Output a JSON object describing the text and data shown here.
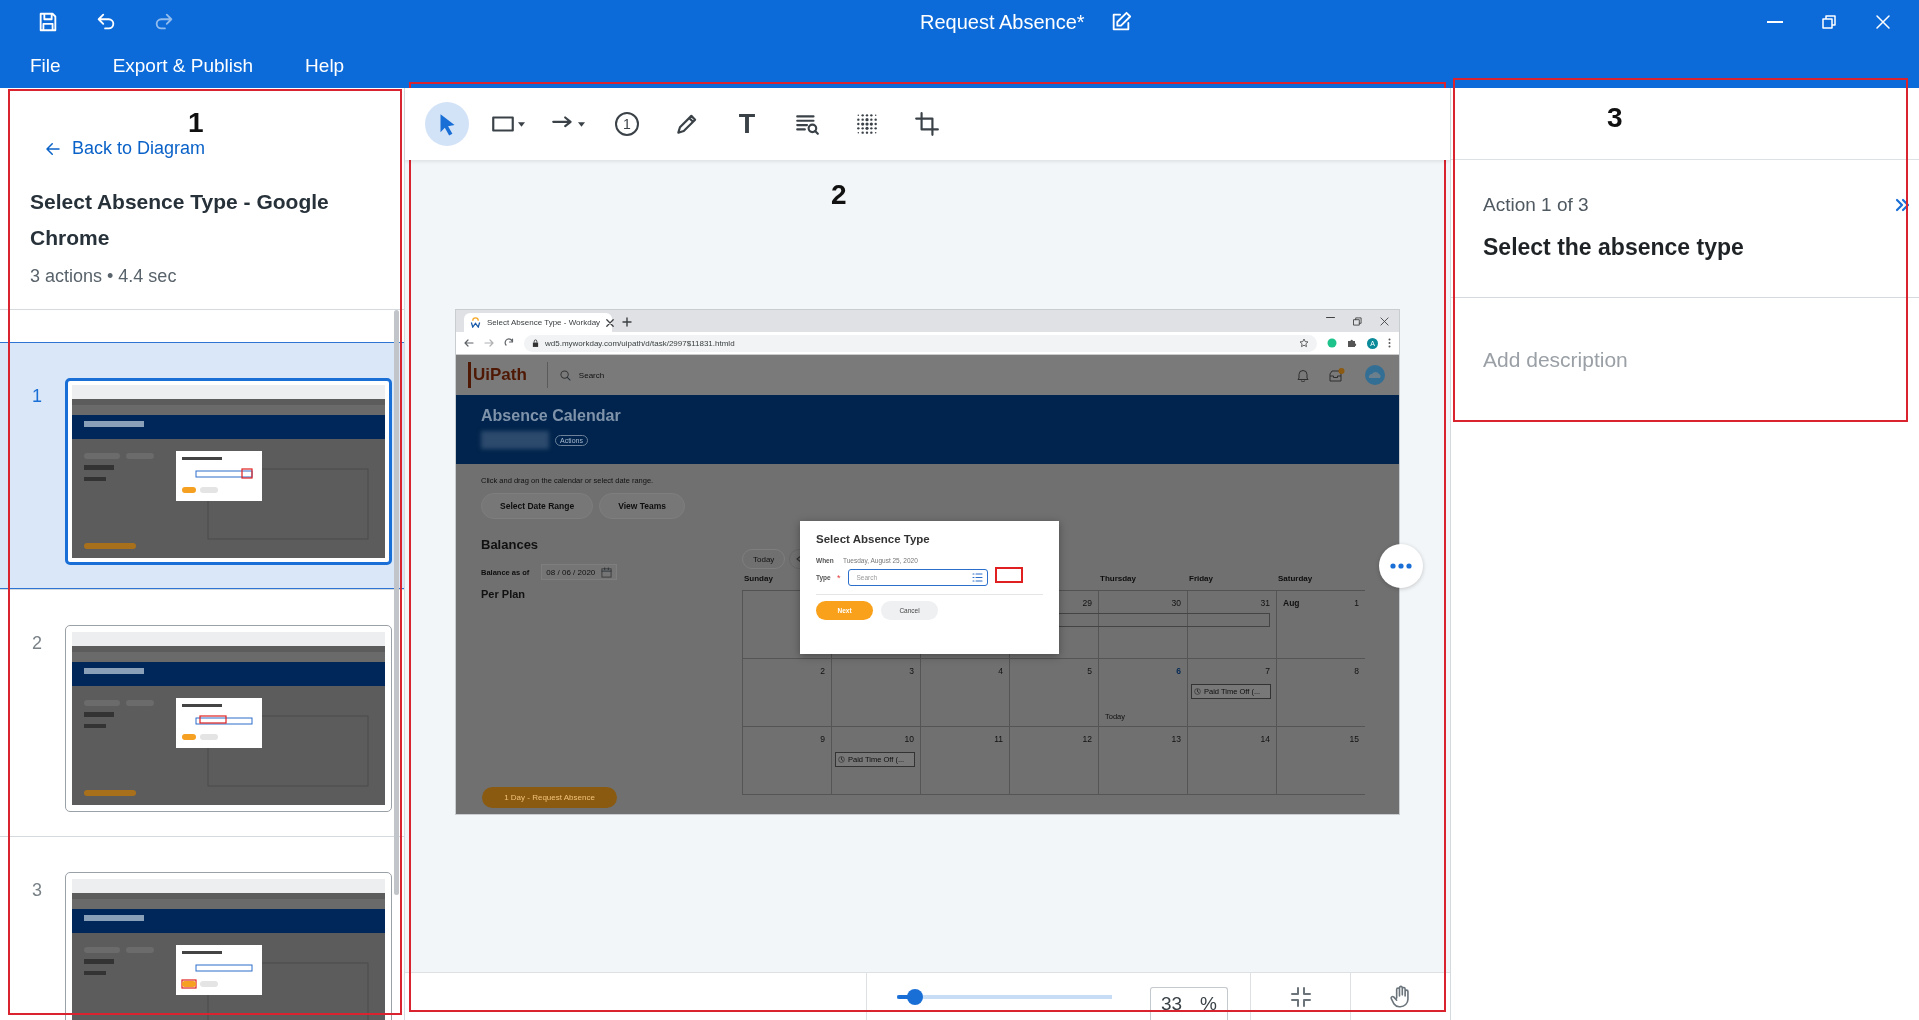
{
  "title_bar": {
    "title": "Request Absence*",
    "history": [
      {
        "kind": "undo",
        "disabled": false
      },
      {
        "kind": "redo",
        "disabled": true
      }
    ]
  },
  "menu": [
    {
      "label": "File"
    },
    {
      "label": "Export & Publish"
    },
    {
      "label": "Help"
    }
  ],
  "left_panel": {
    "back_link": "Back to Diagram",
    "recording_title": "Select Absence Type - Google Chrome",
    "summary": "3 actions • 4.4 sec",
    "steps": [
      {
        "number": "1",
        "selected": true
      },
      {
        "number": "2",
        "selected": false
      },
      {
        "number": "3",
        "selected": false
      }
    ]
  },
  "toolbar": {
    "tools": [
      {
        "kind": "select",
        "selected": true
      },
      {
        "kind": "rectangle",
        "selected": false,
        "has_menu": true
      },
      {
        "kind": "arrow",
        "selected": false,
        "has_menu": true
      },
      {
        "kind": "step",
        "label": "1",
        "selected": false
      },
      {
        "kind": "pen",
        "selected": false
      },
      {
        "kind": "text",
        "label": "T",
        "selected": false
      },
      {
        "kind": "ocr",
        "selected": false
      },
      {
        "kind": "blur",
        "selected": false
      },
      {
        "kind": "crop",
        "selected": false
      }
    ]
  },
  "canvas": {
    "screenshot": {
      "browser": {
        "tab_title": "Select Absence Type - Workday",
        "url": "wd5.myworkday.com/uipath/d/task/2997$11831.htmld",
        "profile_initial": "A"
      },
      "app": {
        "logo": "UiPath",
        "search_placeholder": "Search",
        "page_title": "Absence Calendar",
        "actions_label": "Actions",
        "hint": "Click and drag on the calendar or select date range.",
        "buttons": [
          "Select Date Range",
          "View Teams"
        ],
        "balances_title": "Balances",
        "balance_label": "Balance as of",
        "balance_date": "08 / 06 / 2020",
        "plan_title": "Per Plan",
        "request_button": "1 Day - Request Absence"
      },
      "calendar": {
        "today_button": "Today",
        "weekdays": {
          "first": "Sunday",
          "last_three": [
            "Thursday",
            "Friday",
            "Saturday"
          ]
        },
        "weeks": [
          {
            "bar": true,
            "cells": [
              {},
              {},
              {},
              {
                "day": "29"
              },
              {
                "day": "30"
              },
              {
                "day": "31"
              },
              {
                "month": "Aug",
                "day": "1"
              }
            ]
          },
          {
            "cells": [
              {
                "day": "2"
              },
              {
                "day": "3"
              },
              {
                "day": "4"
              },
              {
                "day": "5"
              },
              {
                "day": "6",
                "today": true,
                "note": "Today"
              },
              {
                "day": "7",
                "event": "Paid Time Off (..."
              },
              {
                "day": "8"
              }
            ]
          },
          {
            "cells": [
              {
                "day": "9"
              },
              {
                "day": "10",
                "event": "Paid Time Off (..."
              },
              {
                "day": "11"
              },
              {
                "day": "12"
              },
              {
                "day": "13"
              },
              {
                "day": "14"
              },
              {
                "day": "15"
              }
            ]
          }
        ]
      },
      "modal": {
        "title": "Select Absence Type",
        "when_label": "When",
        "when_value": "Tuesday, August 25, 2020",
        "type_label": "Type",
        "required_mark": "*",
        "type_placeholder": "Search",
        "click_highlight": true,
        "buttons": [
          {
            "label": "Next",
            "kind": "primary"
          },
          {
            "label": "Cancel",
            "kind": "secondary"
          }
        ]
      }
    }
  },
  "zoom_bar": {
    "level": 0.08,
    "value": "33",
    "unit": "%"
  },
  "right_panel": {
    "action_counter": "Action 1 of 3",
    "action_title": "Select the absence type",
    "description_placeholder": "Add description"
  },
  "callouts": [
    {
      "label": "1"
    },
    {
      "label": "2"
    },
    {
      "label": "3"
    }
  ]
}
